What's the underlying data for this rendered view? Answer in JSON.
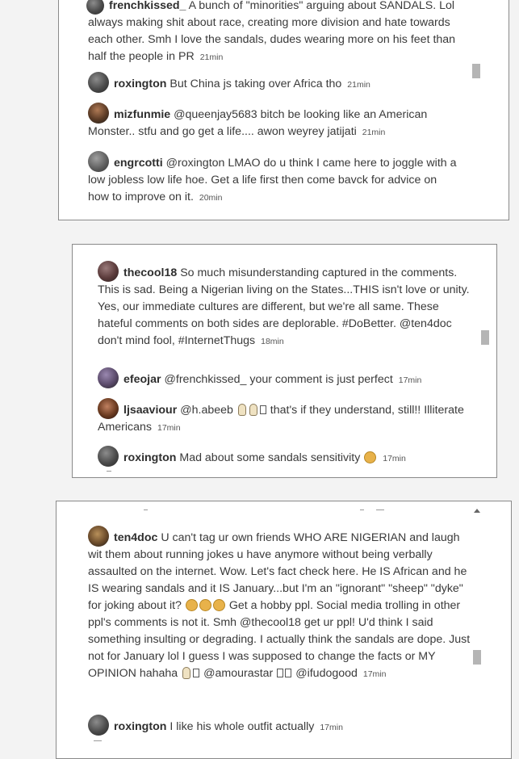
{
  "panel1": {
    "comments": [
      {
        "user": "frenchkissed_",
        "text": "A bunch of \"minorities\" arguing about SANDALS. Lol always making shit about race, creating more division and hate towards each other. Smh I love the sandals, dudes wearing more on his feet than half the people in PR",
        "time": "21min"
      },
      {
        "user": "roxington",
        "text": "But China js taking over Africa tho",
        "time": "21min"
      },
      {
        "user": "mizfunmie",
        "text": "@queenjay5683 bitch be looking like an American Monster.. stfu and go get a life.... awon weyrey jatijati",
        "time": "21min"
      },
      {
        "user": "engrcotti",
        "text": "@roxington LMAO do u think I came here to joggle with a low jobless low life hoe. Get a life first then come bavck for advice on how to improve on it.",
        "time": "20min"
      }
    ]
  },
  "panel2": {
    "comments": [
      {
        "user": "thecool18",
        "text": "So much misunderstanding captured in the comments. This is sad. Being a Nigerian living on the States...THIS isn't love or unity. Yes, our immediate cultures are different, but we're all same. These hateful comments on both sides are deplorable. #DoBetter. @ten4doc don't mind fool, #InternetThugs",
        "time": "18min"
      },
      {
        "user": "efeojar",
        "text": "@frenchkissed_ your comment is just perfect",
        "time": "17min"
      },
      {
        "user": "ljsaaviour",
        "text_a": "@h.abeeb",
        "text_b": "that's if they understand, still!! Illiterate Americans",
        "time": "17min"
      },
      {
        "user": "roxington",
        "text": "Mad about some sandals sensitivity",
        "time": "17min"
      }
    ]
  },
  "panel3": {
    "comments": [
      {
        "user": "ten4doc",
        "text_a": "U can't tag ur own friends WHO ARE NIGERIAN and laugh wit them about running jokes u have anymore without being verbally assaulted on the internet. Wow. Let's fact check here. He IS African and he IS wearing sandals and it IS January...but I'm an \"ignorant\" \"sheep\" \"dyke\" for joking about it?",
        "text_b": "Get a hobby ppl. Social media trolling in other ppl's comments is not it. Smh @thecool18 get ur ppl! U'd think I said something insulting or degrading. I actually think the sandals are dope. Just not for January lol I guess I was supposed to change the facts or MY OPINION hahaha",
        "text_c": "@amourastar",
        "text_d": "@ifudogood",
        "time": "17min"
      },
      {
        "user": "roxington",
        "text": "I like his whole outfit actually",
        "time": "17min"
      }
    ]
  }
}
